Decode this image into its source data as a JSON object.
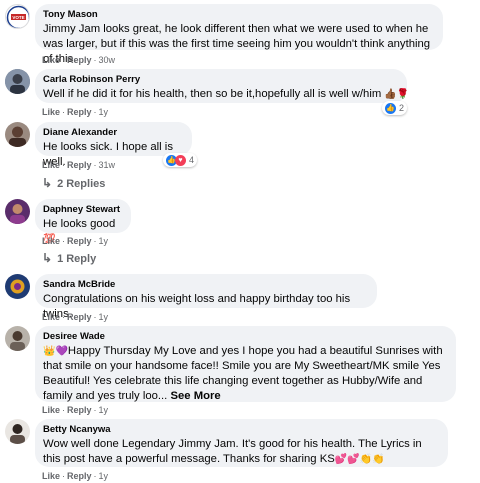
{
  "comments": [
    {
      "name": "Tony Mason",
      "text": "Jimmy Jam looks great, he look different then what we were used to when he was larger, but if this was the first time seeing him you wouldn't think anything of this.",
      "like": "Like",
      "reply": "Reply",
      "time": "30w"
    },
    {
      "name": "Carla Robinson Perry",
      "text": "Well if he did it for his health, then so be it,hopefully all is well w/him",
      "like": "Like",
      "reply": "Reply",
      "time": "1y",
      "reaction_count": "2"
    },
    {
      "name": "Diane Alexander",
      "text": "He looks sick. I hope all is well.",
      "like": "Like",
      "reply": "Reply",
      "time": "31w",
      "reaction_count": "4",
      "replies": "2 Replies"
    },
    {
      "name": "Daphney Stewart",
      "text": "He looks good",
      "like": "Like",
      "reply": "Reply",
      "time": "1y",
      "replies": "1 Reply"
    },
    {
      "name": "Sandra McBride",
      "text": "Congratulations on his weight loss and happy birthday too his twins.",
      "like": "Like",
      "reply": "Reply",
      "time": "1y"
    },
    {
      "name": "Desiree Wade",
      "text": "Happy Thursday My Love and yes I hope you had a beautiful Sunrises with that smile on your handsome face!! Smile you are My Sweetheart/MK smile Yes Beautiful! Yes celebrate this life changing event together as Hubby/Wife and family and yes truly loo...",
      "see_more": "See More",
      "like": "Like",
      "reply": "Reply",
      "time": "1y"
    },
    {
      "name": "Betty Ncanywa",
      "text": "Wow well done Legendary Jimmy Jam. It's good for his health. The Lyrics in this post have a powerful message. Thanks for sharing KS",
      "like": "Like",
      "reply": "Reply",
      "time": "1y"
    }
  ],
  "avatar_badge_text": "VOTE",
  "colors": {
    "bubble": "#f0f2f5",
    "meta": "#65676b",
    "like_blue": "#1877f2",
    "love_red": "#f33e58"
  }
}
